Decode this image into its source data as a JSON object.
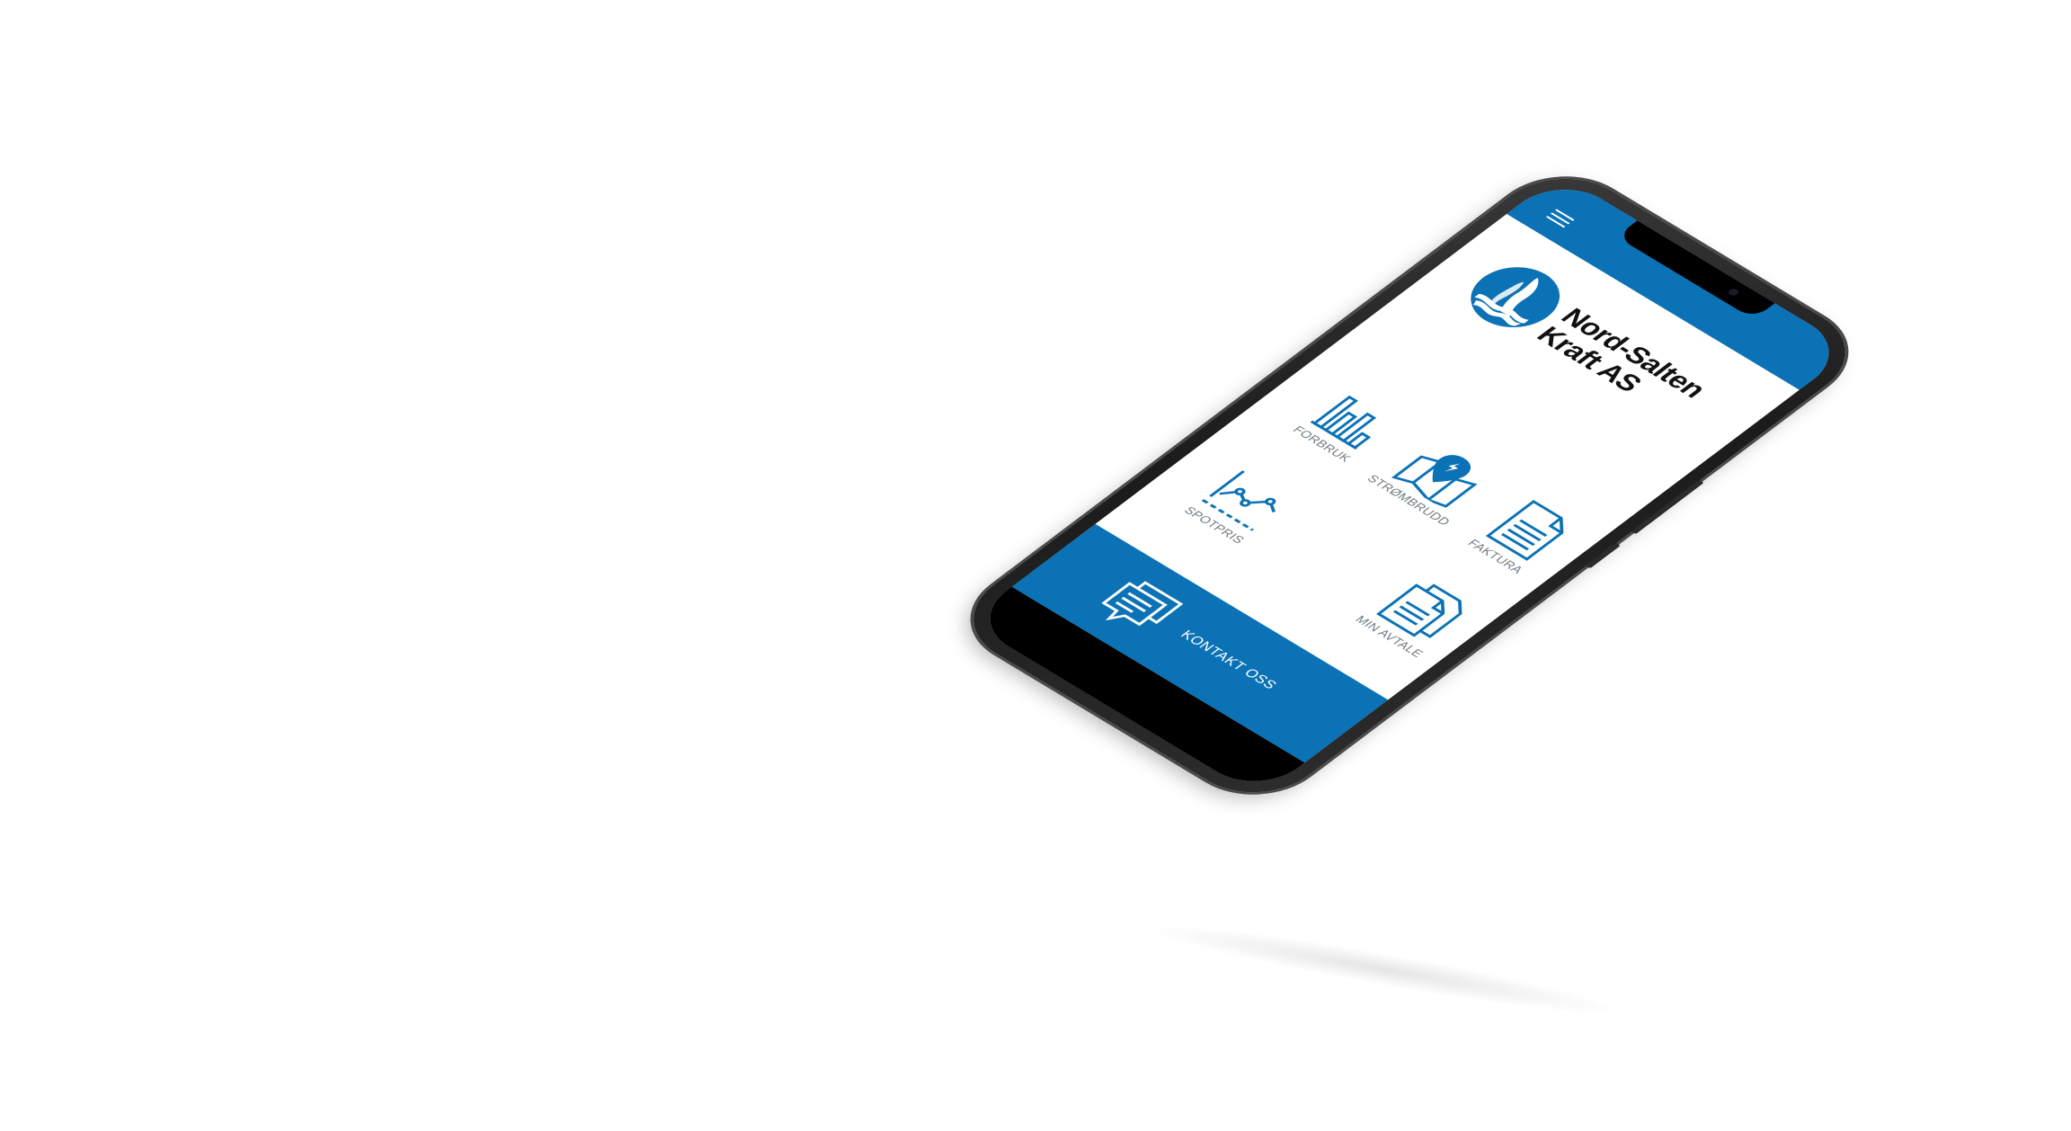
{
  "app": {
    "brand_line1": "Nord-Salten",
    "brand_line2": "Kraft AS",
    "brand_color": "#0b72b6"
  },
  "header": {
    "menu_icon": "hamburger-menu-icon"
  },
  "tiles": [
    {
      "label": "FORBRUK",
      "icon": "bar-chart-icon"
    },
    {
      "label": "STRØMBRUDD",
      "icon": "map-marker-icon"
    },
    {
      "label": "FAKTURA",
      "icon": "document-icon"
    },
    {
      "label": "SPOTPRIS",
      "icon": "line-chart-icon"
    },
    {
      "label": "MIN AVTALE",
      "icon": "documents-icon"
    }
  ],
  "footer": {
    "contact_label": "KONTAKT OSS",
    "contact_icon": "chat-bubbles-icon"
  }
}
